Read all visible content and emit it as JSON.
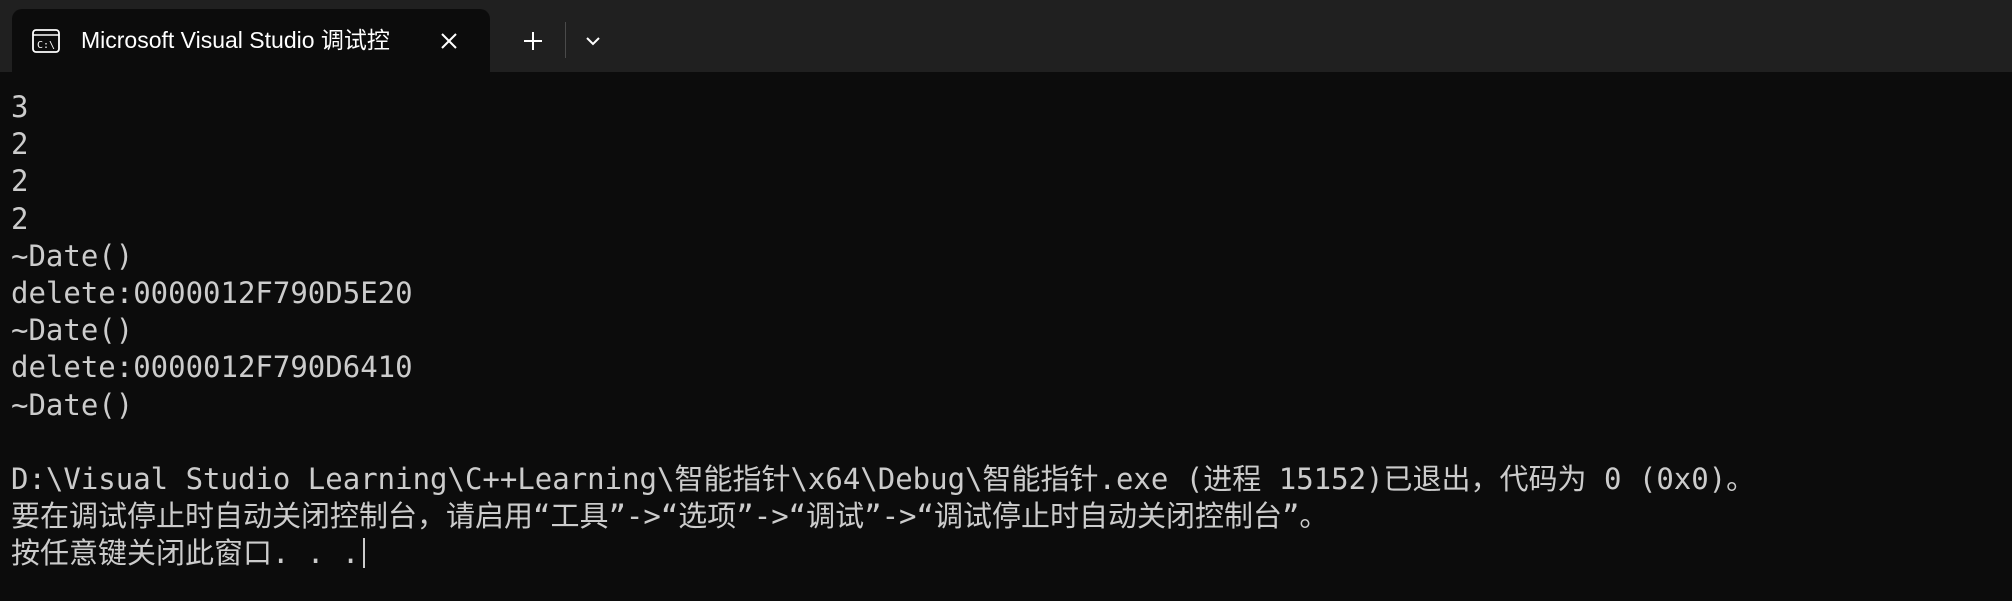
{
  "tab": {
    "title": "Microsoft Visual Studio 调试控",
    "icon": "console-icon"
  },
  "colors": {
    "background": "#0c0c0c",
    "tabbar": "#202020",
    "text": "#cccccc"
  },
  "console": {
    "lines": [
      "3",
      "2",
      "2",
      "2",
      "~Date()",
      "delete:0000012F790D5E20",
      "~Date()",
      "delete:0000012F790D6410",
      "~Date()",
      "",
      "D:\\Visual Studio Learning\\C++Learning\\智能指针\\x64\\Debug\\智能指针.exe (进程 15152)已退出，代码为 0 (0x0)。",
      "要在调试停止时自动关闭控制台，请启用“工具”->“选项”->“调试”->“调试停止时自动关闭控制台”。",
      "按任意键关闭此窗口. . ."
    ]
  }
}
